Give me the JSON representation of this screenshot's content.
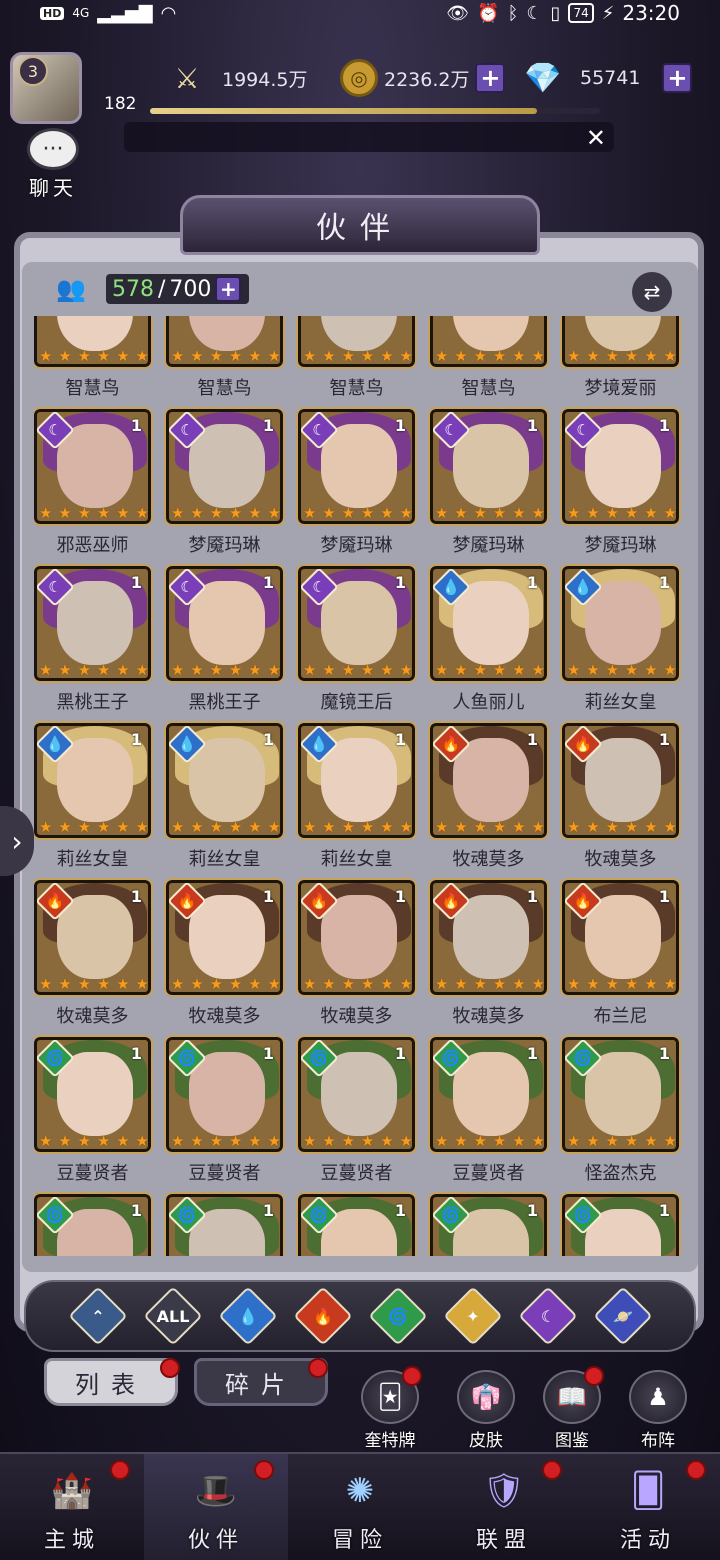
{
  "status": {
    "time": "23:20",
    "battery": "74",
    "hd": "HD",
    "network": "4G"
  },
  "player": {
    "level": "3",
    "energy": "182"
  },
  "resources": {
    "power": "1994.5万",
    "gold": "2236.2万",
    "diamond": "55741"
  },
  "exp_progress": 0.86,
  "chat": {
    "label": "聊天"
  },
  "panel": {
    "title": "伙伴",
    "count_current": "578",
    "count_max": "700"
  },
  "colors": {
    "light": "#7a3fb8",
    "water": "#2e6fc9",
    "fire": "#c83a1e",
    "wind": "#2f9a4a",
    "holy": "#d6a93a",
    "dark": "#5b2d9c"
  },
  "heroes": [
    [
      {
        "name": "智慧鸟",
        "element": "light",
        "count": "1"
      },
      {
        "name": "智慧鸟",
        "element": "light",
        "count": "1"
      },
      {
        "name": "智慧鸟",
        "element": "light",
        "count": "1"
      },
      {
        "name": "智慧鸟",
        "element": "light",
        "count": "1"
      },
      {
        "name": "梦境爱丽",
        "element": "light",
        "count": "1"
      }
    ],
    [
      {
        "name": "邪恶巫师",
        "element": "light",
        "count": "1"
      },
      {
        "name": "梦魇玛琳",
        "element": "light",
        "count": "1"
      },
      {
        "name": "梦魇玛琳",
        "element": "light",
        "count": "1"
      },
      {
        "name": "梦魇玛琳",
        "element": "light",
        "count": "1"
      },
      {
        "name": "梦魇玛琳",
        "element": "light",
        "count": "1"
      }
    ],
    [
      {
        "name": "黑桃王子",
        "element": "light",
        "count": "1"
      },
      {
        "name": "黑桃王子",
        "element": "light",
        "count": "1"
      },
      {
        "name": "魔镜王后",
        "element": "light",
        "count": "1"
      },
      {
        "name": "人鱼丽儿",
        "element": "water",
        "count": "1"
      },
      {
        "name": "莉丝女皇",
        "element": "water",
        "count": "1"
      }
    ],
    [
      {
        "name": "莉丝女皇",
        "element": "water",
        "count": "1"
      },
      {
        "name": "莉丝女皇",
        "element": "water",
        "count": "1"
      },
      {
        "name": "莉丝女皇",
        "element": "water",
        "count": "1"
      },
      {
        "name": "牧魂莫多",
        "element": "fire",
        "count": "1"
      },
      {
        "name": "牧魂莫多",
        "element": "fire",
        "count": "1"
      }
    ],
    [
      {
        "name": "牧魂莫多",
        "element": "fire",
        "count": "1"
      },
      {
        "name": "牧魂莫多",
        "element": "fire",
        "count": "1"
      },
      {
        "name": "牧魂莫多",
        "element": "fire",
        "count": "1"
      },
      {
        "name": "牧魂莫多",
        "element": "fire",
        "count": "1"
      },
      {
        "name": "布兰尼",
        "element": "fire",
        "count": "1"
      }
    ],
    [
      {
        "name": "豆蔓贤者",
        "element": "wind",
        "count": "1"
      },
      {
        "name": "豆蔓贤者",
        "element": "wind",
        "count": "1"
      },
      {
        "name": "豆蔓贤者",
        "element": "wind",
        "count": "1"
      },
      {
        "name": "豆蔓贤者",
        "element": "wind",
        "count": "1"
      },
      {
        "name": "怪盗杰克",
        "element": "wind",
        "count": "1"
      }
    ],
    [
      {
        "name": "",
        "element": "wind",
        "count": "1"
      },
      {
        "name": "",
        "element": "wind",
        "count": "1"
      },
      {
        "name": "",
        "element": "wind",
        "count": "1"
      },
      {
        "name": "",
        "element": "wind",
        "count": "1"
      },
      {
        "name": "",
        "element": "wind",
        "count": "1"
      }
    ]
  ],
  "filters": [
    {
      "icon": "arrow-up-icon",
      "glyph": "⌃",
      "color": "#3a5a8a"
    },
    {
      "icon": "all-icon",
      "glyph": "ALL",
      "color": "#3a3a48"
    },
    {
      "icon": "water-icon",
      "glyph": "💧",
      "color": "#2e6fc9"
    },
    {
      "icon": "fire-icon",
      "glyph": "🔥",
      "color": "#c83a1e"
    },
    {
      "icon": "wind-icon",
      "glyph": "🌀",
      "color": "#2f9a4a"
    },
    {
      "icon": "holy-icon",
      "glyph": "✦",
      "color": "#d6a93a"
    },
    {
      "icon": "dark-icon",
      "glyph": "☾",
      "color": "#7a3fb8"
    },
    {
      "icon": "planet-icon",
      "glyph": "🪐",
      "color": "#3f4db8"
    }
  ],
  "tabs": {
    "list": "列表",
    "shards": "碎片"
  },
  "tools": {
    "tarot": "奎特牌",
    "skin": "皮肤",
    "atlas": "图鉴",
    "formation": "布阵"
  },
  "nav": {
    "city": "主城",
    "partner": "伙伴",
    "adventure": "冒险",
    "alliance": "联盟",
    "event": "活动"
  }
}
